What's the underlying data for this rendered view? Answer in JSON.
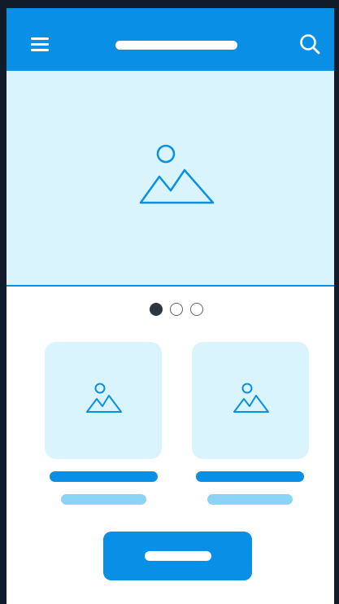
{
  "colors": {
    "page_background": "#111b2a",
    "accent": "#0a8fe6",
    "image_placeholder_fill": "#d9f4fd",
    "subtitle_line": "#8bd4f5",
    "dot_active": "#2f3640"
  },
  "header": {
    "menu_icon": "hamburger-menu-icon",
    "title_placeholder": "title-bar-placeholder",
    "search_icon": "search-icon"
  },
  "hero": {
    "icon": "image-placeholder-icon"
  },
  "carousel": {
    "page_count": 3,
    "active_index": 0
  },
  "cards": [
    {
      "icon": "image-placeholder-icon"
    },
    {
      "icon": "image-placeholder-icon"
    }
  ],
  "cta": {
    "label_placeholder": "button-label-placeholder"
  }
}
